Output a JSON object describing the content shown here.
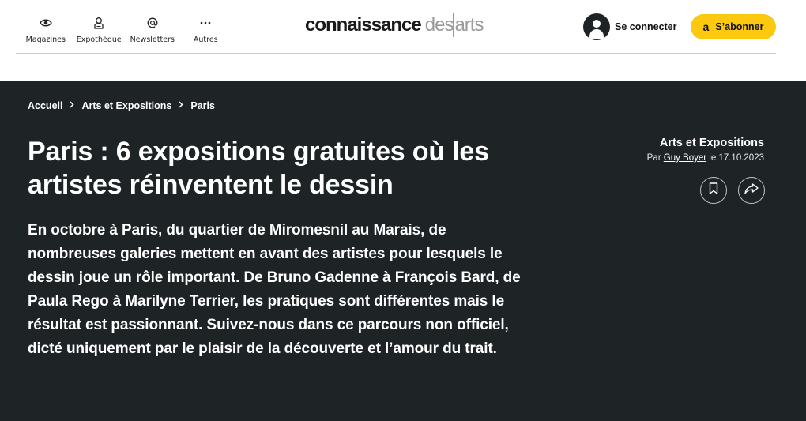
{
  "header": {
    "nav": [
      {
        "label": "Magazines",
        "icon": "eye-icon"
      },
      {
        "label": "Expothèque",
        "icon": "person-icon"
      },
      {
        "label": "Newsletters",
        "icon": "at-icon"
      },
      {
        "label": "Autres",
        "icon": "more-icon"
      }
    ],
    "logo": {
      "main": "connaissance",
      "sub1": "des",
      "sub2": "arts"
    },
    "login_label": "Se connecter",
    "subscribe": {
      "icon_glyph": "a",
      "label": "S’abonner",
      "color": "#fdc90f"
    }
  },
  "breadcrumb": [
    "Accueil",
    "Arts et Expositions",
    "Paris"
  ],
  "article": {
    "title": "Paris : 6 expositions gratuites où les artistes réinventent le dessin",
    "lead": "En octobre à Paris, du quartier de Miromesnil au Marais, de nombreuses galeries mettent en avant des artistes pour lesquels le dessin joue un rôle important. De Bruno Gadenne à François Bard, de Paula Rego à Marilyne Terrier, les pratiques sont différentes mais le résultat est passionnant. Suivez-nous dans ce parcours non officiel, dicté uniquement par le plaisir de la découverte et l’amour du trait.",
    "category": "Arts et Expositions",
    "by_prefix": "Par",
    "author": "Guy Boyer",
    "date_prefix": "le",
    "date": "17.10.2023"
  },
  "colors": {
    "hero_bg": "#1e2426",
    "accent": "#fdc90f"
  }
}
